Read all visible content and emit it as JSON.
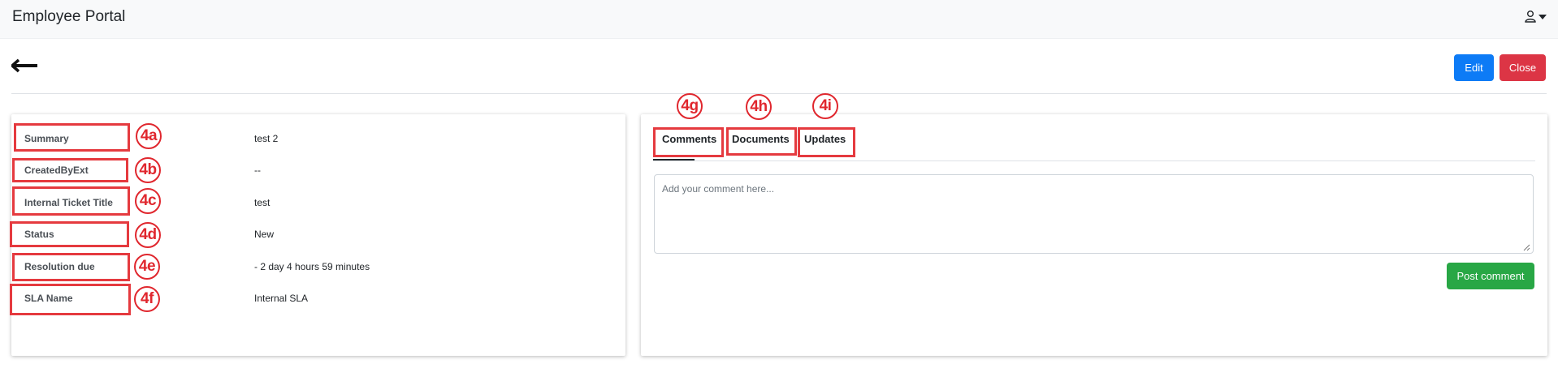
{
  "header": {
    "title": "Employee Portal",
    "user_icon": "user-icon"
  },
  "toolbar": {
    "back_icon": "arrow-left-icon",
    "edit_label": "Edit",
    "close_label": "Close"
  },
  "details": {
    "fields": [
      {
        "label": "Summary",
        "value": "test 2",
        "marker": "4a"
      },
      {
        "label": "CreatedByExt",
        "value": "--",
        "marker": "4b"
      },
      {
        "label": "Internal Ticket Title",
        "value": "test",
        "marker": "4c"
      },
      {
        "label": "Status",
        "value": "New",
        "marker": "4d"
      },
      {
        "label": "Resolution due",
        "value": "- 2 day 4 hours 59 minutes",
        "marker": "4e"
      },
      {
        "label": "SLA Name",
        "value": "Internal SLA",
        "marker": "4f"
      }
    ]
  },
  "tabs": [
    {
      "label": "Comments",
      "marker": "4g",
      "active": true
    },
    {
      "label": "Documents",
      "marker": "4h",
      "active": false
    },
    {
      "label": "Updates",
      "marker": "4i",
      "active": false
    }
  ],
  "comment": {
    "placeholder": "Add your comment here...",
    "value": "",
    "post_label": "Post comment"
  },
  "colors": {
    "primary": "#0d7bf6",
    "danger": "#dc3545",
    "success": "#28a745",
    "annotation": "#e53a3f"
  }
}
